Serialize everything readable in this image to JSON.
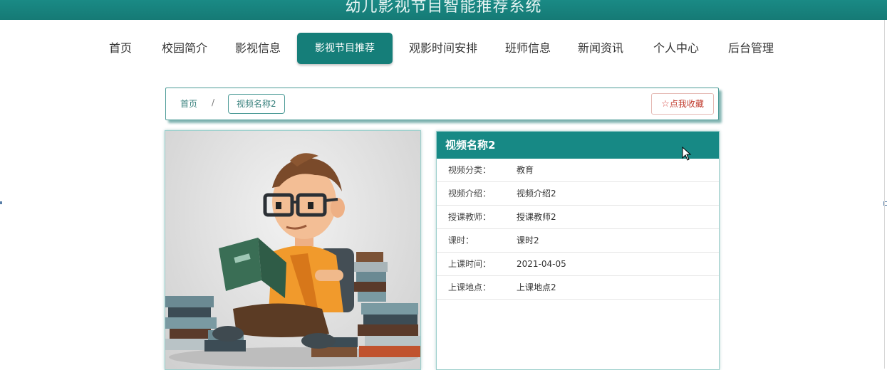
{
  "header": {
    "title": "幼儿影视节目智能推荐系统"
  },
  "nav": {
    "items": [
      {
        "label": "首页"
      },
      {
        "label": "校园简介"
      },
      {
        "label": "影视信息"
      },
      {
        "label": "影视节目推荐",
        "active": true
      },
      {
        "label": "观影时间安排"
      },
      {
        "label": "班师信息"
      },
      {
        "label": "新闻资讯"
      },
      {
        "label": "个人中心"
      },
      {
        "label": "后台管理"
      }
    ]
  },
  "breadcrumb": {
    "home": "首页",
    "separator": "/",
    "current": "视频名称2",
    "favorite_label": "点我收藏",
    "favorite_icon": "star-outline-icon"
  },
  "detail": {
    "title": "视频名称2",
    "fields": [
      {
        "key": "视频分类：",
        "value": "教育"
      },
      {
        "key": "视频介绍：",
        "value": "视频介绍2"
      },
      {
        "key": "授课教师：",
        "value": "授课教师2"
      },
      {
        "key": "课时：",
        "value": "课时2"
      },
      {
        "key": "上课时间：",
        "value": "2021-04-05"
      },
      {
        "key": "上课地点：",
        "value": "上课地点2"
      }
    ]
  },
  "colors": {
    "accent": "#157e79",
    "favorite": "#d9534f"
  }
}
